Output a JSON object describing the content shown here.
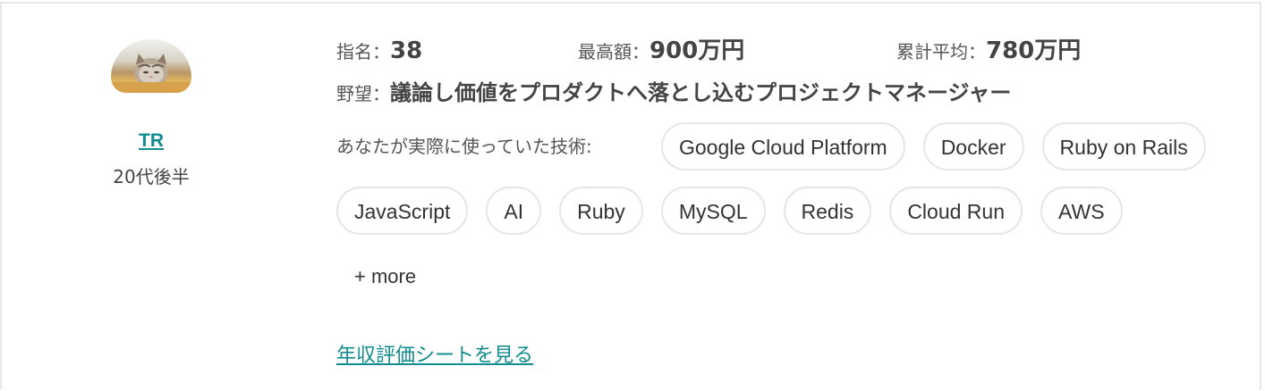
{
  "profile": {
    "avatar_icon": "cat-avatar-image",
    "name": "TR",
    "age": "20代後半"
  },
  "stats": {
    "nominated_label": "指名：",
    "nominated_value": "38",
    "highest_label": "最高額：",
    "highest_value": "900万円",
    "average_label": "累計平均：",
    "average_value": "780万円"
  },
  "ambition": {
    "label": "野望：",
    "value": "議論し価値をプロダクトへ落とし込むプロジェクトマネージャー"
  },
  "tech": {
    "label": "あなたが実際に使っていた技術:",
    "tags": [
      "Google Cloud Platform",
      "Docker",
      "Ruby on Rails",
      "JavaScript",
      "AI",
      "Ruby",
      "MySQL",
      "Redis",
      "Cloud Run",
      "AWS"
    ],
    "more_label": "+ more"
  },
  "links": {
    "sheet_label": "年収評価シートを見る"
  },
  "colors": {
    "accent": "#118c90",
    "text": "#444444",
    "tag_border": "#e6e6e6"
  }
}
